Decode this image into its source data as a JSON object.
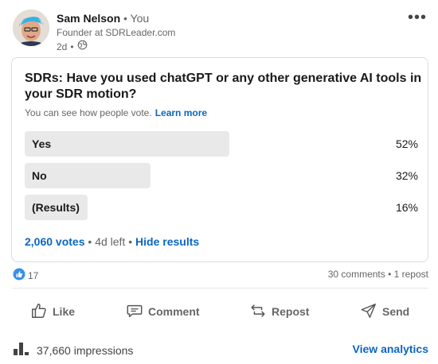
{
  "post": {
    "author_name": "Sam Nelson",
    "author_relation": "You",
    "headline": "Founder at SDRLeader.com",
    "age": "2d",
    "visibility_icon": "globe-icon",
    "more_icon": "more-icon"
  },
  "poll": {
    "question": "SDRs: Have you used chatGPT or any other generative AI tools in your SDR motion?",
    "visibility_note": "You can see how people vote.",
    "learn_more": "Learn more",
    "options": [
      {
        "label": "Yes",
        "percent": "52%",
        "fraction": 0.52
      },
      {
        "label": "No",
        "percent": "32%",
        "fraction": 0.32
      },
      {
        "label": "(Results)",
        "percent": "16%",
        "fraction": 0.16
      }
    ],
    "votes": "2,060 votes",
    "time_left": "4d left",
    "hide_results": "Hide results",
    "bar_color": "#e9e9e9"
  },
  "social": {
    "reaction_icon": "like-reaction-icon",
    "reaction_count": "17",
    "counts": "30 comments • 1 repost"
  },
  "actions": {
    "like": "Like",
    "comment": "Comment",
    "repost": "Repost",
    "send": "Send"
  },
  "impressions": {
    "icon": "bar-chart-icon",
    "label": "37,660 impressions",
    "view_analytics": "View analytics"
  },
  "colors": {
    "link": "#0a66c2",
    "muted": "#666666"
  }
}
